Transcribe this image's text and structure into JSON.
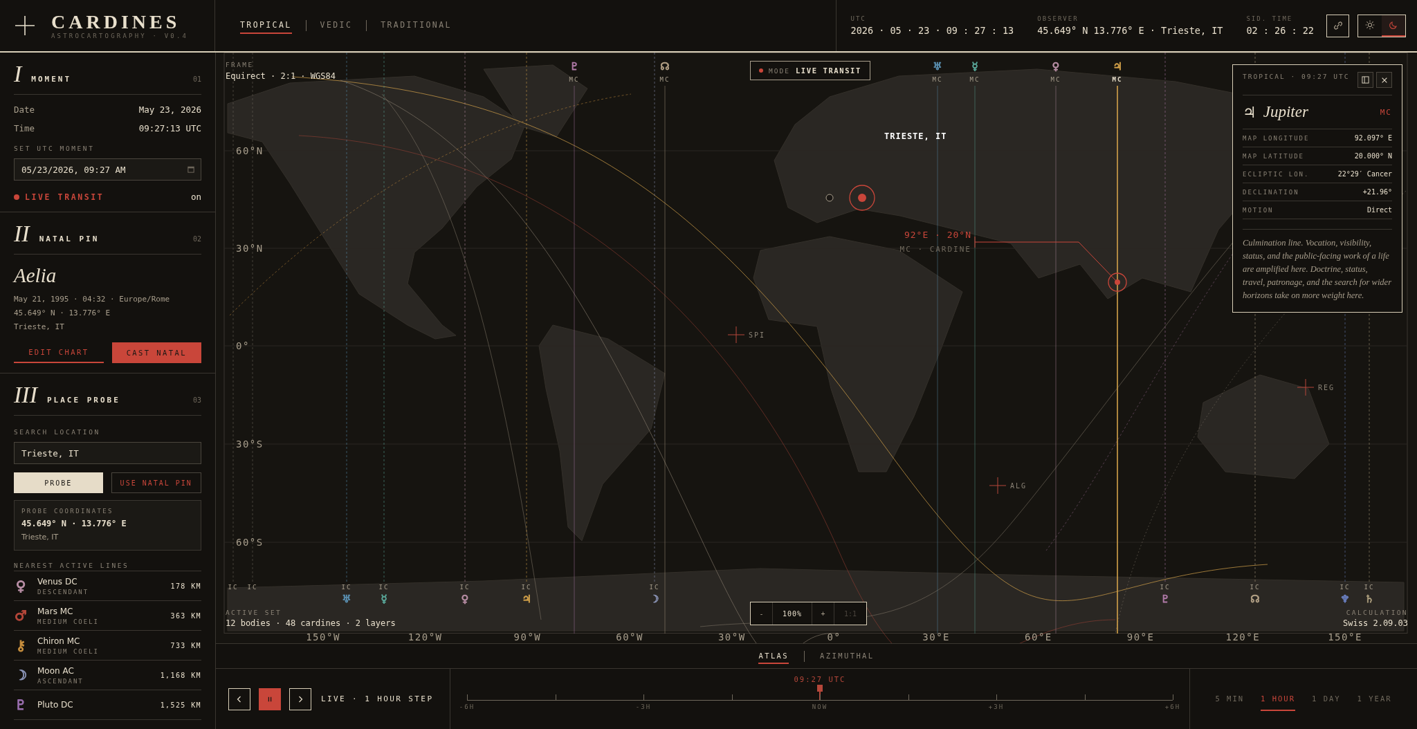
{
  "brand": {
    "name": "CARDINES",
    "tagline": "ASTROCARTOGRAPHY · V0.4"
  },
  "zodiac_tabs": [
    {
      "label": "TROPICAL",
      "selected": true
    },
    {
      "label": "VEDIC",
      "selected": false
    },
    {
      "label": "TRADITIONAL",
      "selected": false
    }
  ],
  "readouts": [
    {
      "label": "UTC",
      "value": "2026 · 05 · 23 · 09 : 27 : 13"
    },
    {
      "label": "OBSERVER",
      "value": "45.649° N 13.776° E · Trieste, IT"
    },
    {
      "label": "SID. TIME",
      "value": "02 : 26 : 22"
    }
  ],
  "theme_toggle": [
    {
      "kind": "sun",
      "selected": false
    },
    {
      "kind": "moon",
      "selected": true
    }
  ],
  "moment": {
    "numeral": "I",
    "title": "MOMENT",
    "index": "01",
    "fields": [
      {
        "label": "Date",
        "value": "May 23, 2026"
      },
      {
        "label": "Time",
        "value": "09:27:13 UTC"
      }
    ],
    "input_label": "SET UTC MOMENT",
    "input_value": "05/23/2026, 09:27 AM",
    "live": {
      "label": "LIVE TRANSIT",
      "value": "on",
      "on": true
    }
  },
  "natal": {
    "numeral": "II",
    "title": "NATAL PIN",
    "index": "02",
    "name": "Aelia",
    "details": [
      "May 21, 1995 · 04:32 · Europe/Rome",
      "45.649° N · 13.776° E",
      "Trieste, IT"
    ],
    "buttons": [
      "EDIT CHART",
      "CAST NATAL"
    ]
  },
  "probe": {
    "numeral": "III",
    "title": "PLACE PROBE",
    "index": "03",
    "search_label": "SEARCH LOCATION",
    "search_value": "Trieste, IT",
    "buttons": [
      "PROBE",
      "USE NATAL PIN"
    ],
    "coords_label": "PROBE COORDINATES",
    "coords": "45.649° N · 13.776° E",
    "place": "Trieste, IT",
    "nearest_label": "NEAREST ACTIVE LINES",
    "nearest": [
      {
        "symbol": "♀",
        "name": "Venus DC",
        "angle": "DESCENDANT",
        "distance": "178 KM",
        "color": "#b98fa6"
      },
      {
        "symbol": "♂",
        "name": "Mars MC",
        "angle": "MEDIUM COELI",
        "distance": "363 KM",
        "color": "#b5473a"
      },
      {
        "symbol": "⚷",
        "name": "Chiron MC",
        "angle": "MEDIUM COELI",
        "distance": "733 KM",
        "color": "#c9903e"
      },
      {
        "symbol": "☽",
        "name": "Moon AC",
        "angle": "ASCENDANT",
        "distance": "1,168 KM",
        "color": "#8a93b5"
      },
      {
        "symbol": "♇",
        "name": "Pluto DC",
        "distance": "1,525 KM",
        "color": "#9b6fb0"
      }
    ]
  },
  "map": {
    "frame_label": "FRAME",
    "frame_value": "Equirect · 2:1 · WGS84",
    "mode_label": "MODE",
    "mode_value": "LIVE TRANSIT",
    "lat_labels": [
      "60°N",
      "30°N",
      "0°",
      "30°S",
      "60°S"
    ],
    "lon_labels": [
      "150°W",
      "120°W",
      "90°W",
      "60°W",
      "30°W",
      "0°",
      "30°E",
      "60°E",
      "90°E",
      "120°E",
      "150°E"
    ],
    "mc_lines": [
      {
        "symbol": "♇",
        "label": "MC",
        "color": "#b07aa8",
        "selected": false
      },
      {
        "symbol": "☊",
        "label": "MC",
        "color": "#b3a186",
        "selected": false
      },
      {
        "symbol": "♅",
        "label": "MC",
        "color": "#5a8fb0",
        "selected": false
      },
      {
        "symbol": "☿",
        "label": "MC",
        "color": "#5aa89a",
        "selected": false
      },
      {
        "symbol": "♀",
        "label": "MC",
        "color": "#b98fa6",
        "selected": false
      },
      {
        "symbol": "♃",
        "label": "MC",
        "color": "#d4a24a",
        "selected": true
      }
    ],
    "ic_lines": [
      {
        "label": "IC"
      },
      {
        "label": "IC"
      },
      {
        "symbol": "♅",
        "label": "IC",
        "color": "#5a8fb0"
      },
      {
        "symbol": "☿",
        "label": "IC",
        "color": "#5aa89a"
      },
      {
        "symbol": "♀",
        "label": "IC",
        "color": "#b98fa6"
      },
      {
        "symbol": "♃",
        "label": "IC",
        "color": "#d4a24a"
      },
      {
        "symbol": "☽",
        "label": "IC",
        "color": "#8a93b5"
      },
      {
        "symbol": "♇",
        "label": "IC",
        "color": "#b07aa8"
      },
      {
        "symbol": "☊",
        "label": "IC",
        "color": "#b3a186"
      },
      {
        "symbol": "♆",
        "label": "IC",
        "color": "#6a7fc0"
      },
      {
        "symbol": "♄",
        "label": "IC",
        "color": "#a89a7a"
      }
    ],
    "observer_label": "TRIESTE, IT",
    "pin_label": "92°E · 20°N",
    "pin_sublabel": "MC · CARDINE",
    "stars": [
      {
        "label": "SPI"
      },
      {
        "label": "REG"
      },
      {
        "label": "ALG"
      }
    ],
    "active_set_label": "ACTIVE SET",
    "active_set_value": "12 bodies · 48 cardines · 2 layers",
    "calc_label": "CALCULATION",
    "calc_value": "Swiss 2.09.03",
    "zoom": {
      "minus": "-",
      "value": "100%",
      "plus": "+",
      "reset": "1:1",
      "reset_disabled": true
    }
  },
  "panel": {
    "meta": "TROPICAL · 09:27 UTC",
    "symbol": "♃",
    "planet": "Jupiter",
    "angle": "MC",
    "rows": [
      {
        "label": "MAP LONGITUDE",
        "value": "92.097° E"
      },
      {
        "label": "MAP LATITUDE",
        "value": "20.000° N"
      },
      {
        "label": "ECLIPTIC LON.",
        "value": "22°29′ Cancer"
      },
      {
        "label": "DECLINATION",
        "value": "+21.96°"
      },
      {
        "label": "MOTION",
        "value": "Direct"
      }
    ],
    "description": "Culmination line. Vocation, visibility, status, and the public-facing work of a life are amplified here. Doctrine, status, travel, patronage, and the search for wider horizons take on more weight here."
  },
  "view_tabs": [
    {
      "label": "ATLAS",
      "selected": true
    },
    {
      "label": "AZIMUTHAL",
      "selected": false
    }
  ],
  "timeline": {
    "playing": true,
    "status": "LIVE · 1 HOUR STEP",
    "now_label": "09:27 UTC",
    "ticks": [
      "-6H",
      "-3H",
      "NOW",
      "+3H",
      "+6H"
    ],
    "level": 0.5,
    "steps": [
      {
        "label": "5 MIN",
        "selected": false
      },
      {
        "label": "1 HOUR",
        "selected": true
      },
      {
        "label": "1 DAY",
        "selected": false
      },
      {
        "label": "1 YEAR",
        "selected": false
      }
    ]
  }
}
